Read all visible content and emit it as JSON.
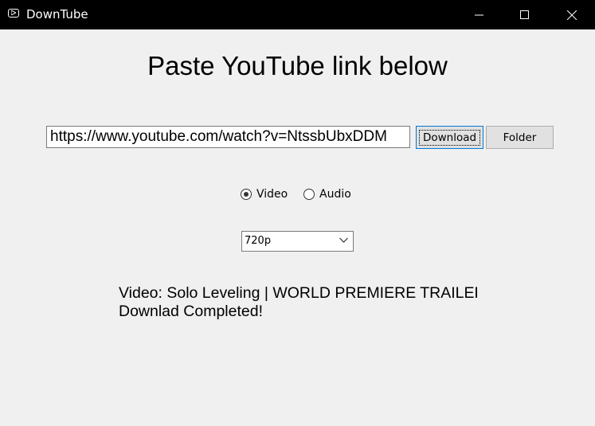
{
  "window": {
    "title": "DownTube",
    "icon": "youtube-play-icon",
    "controls": [
      "minimize-icon",
      "maximize-icon",
      "close-icon"
    ]
  },
  "main": {
    "heading": "Paste YouTube link below",
    "url_value": "https://www.youtube.com/watch?v=NtssbUbxDDM",
    "download_label": "Download",
    "folder_label": "Folder",
    "format_options": [
      {
        "label": "Video",
        "selected": true
      },
      {
        "label": "Audio",
        "selected": false
      }
    ],
    "quality_selected": "720p",
    "status_line1": "Video: Solo Leveling | WORLD PREMIERE TRAILER",
    "status_line2": "Downlad Completed!"
  }
}
